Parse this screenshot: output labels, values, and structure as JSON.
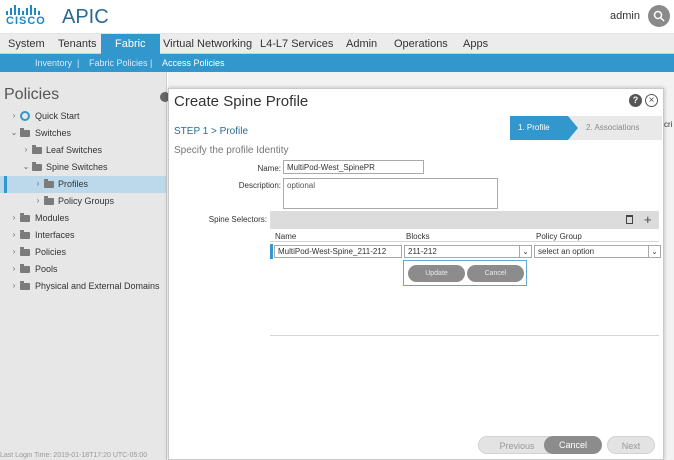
{
  "header": {
    "logo_text": "CISCO",
    "app_title": "APIC",
    "user": "admin"
  },
  "nav": {
    "items": [
      "System",
      "Tenants",
      "Fabric",
      "Virtual Networking",
      "L4-L7 Services",
      "Admin",
      "Operations",
      "Apps"
    ],
    "active": "Fabric"
  },
  "subnav": {
    "items": [
      "Inventory",
      "Fabric Policies",
      "Access Policies"
    ],
    "separator": "|",
    "active": "Access Policies"
  },
  "left_panel": {
    "title": "Policies",
    "tree": [
      {
        "label": "Quick Start"
      },
      {
        "label": "Switches"
      },
      {
        "label": "Leaf Switches"
      },
      {
        "label": "Spine Switches"
      },
      {
        "label": "Profiles",
        "selected": true
      },
      {
        "label": "Policy Groups"
      },
      {
        "label": "Modules"
      },
      {
        "label": "Interfaces"
      },
      {
        "label": "Policies"
      },
      {
        "label": "Pools"
      },
      {
        "label": "Physical and External Domains"
      }
    ],
    "status": "Last Login Time: 2019-01-18T17:20 UTC-05:00"
  },
  "dialog": {
    "title": "Create Spine Profile",
    "step_label": "STEP 1 > Profile",
    "wizard_steps": [
      "1. Profile",
      "2. Associations"
    ],
    "subtitle": "Specify the profile Identity",
    "name_label": "Name:",
    "name_value": "MultiPod-West_SpinePR",
    "description_label": "Description:",
    "description_placeholder": "optional",
    "selectors_label": "Spine Selectors:",
    "table_headers": [
      "Name",
      "Blocks",
      "Policy Group"
    ],
    "row": {
      "name": "MultiPod-West-Spine_211-212",
      "blocks": "211-212",
      "policy_group_placeholder": "select an option"
    },
    "popup_buttons": {
      "update": "Update",
      "cancel": "Cancel"
    },
    "footer": {
      "previous": "Previous",
      "cancel": "Cancel",
      "next": "Next"
    }
  },
  "background": {
    "right_edge_text": "cri"
  },
  "colors": {
    "accent": "#3197cd",
    "title_blue": "#2b6a94"
  }
}
